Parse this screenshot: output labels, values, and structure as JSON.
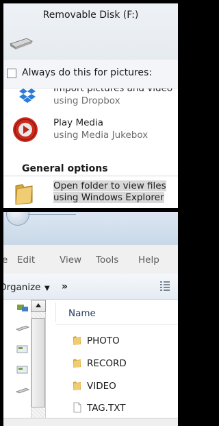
{
  "autoplay": {
    "title": "Removable Disk (F:)",
    "always_label": "Always do this for pictures:",
    "options": [
      {
        "action": "Import pictures and video",
        "app": "using Dropbox"
      },
      {
        "action": "Play Media",
        "app": "using Media Jukebox"
      }
    ],
    "general_options_label": "General options",
    "general_options": [
      {
        "action": "Open folder to view files",
        "app": "using Windows Explorer"
      }
    ]
  },
  "explorer": {
    "menu": [
      "e",
      "Edit",
      "View",
      "Tools",
      "Help"
    ],
    "toolbar": {
      "organize_label": "Organize",
      "caret": "▼",
      "more": "»"
    },
    "column_header": "Name",
    "files": [
      {
        "name": "PHOTO",
        "type": "folder"
      },
      {
        "name": "RECORD",
        "type": "folder"
      },
      {
        "name": "VIDEO",
        "type": "folder"
      },
      {
        "name": "TAG.TXT",
        "type": "text-file"
      }
    ]
  },
  "colors": {
    "folder": "#e8b94a",
    "dropbox": "#2d7bd8",
    "media_red": "#cc2a1e",
    "highlight": "#d8d8d8"
  }
}
